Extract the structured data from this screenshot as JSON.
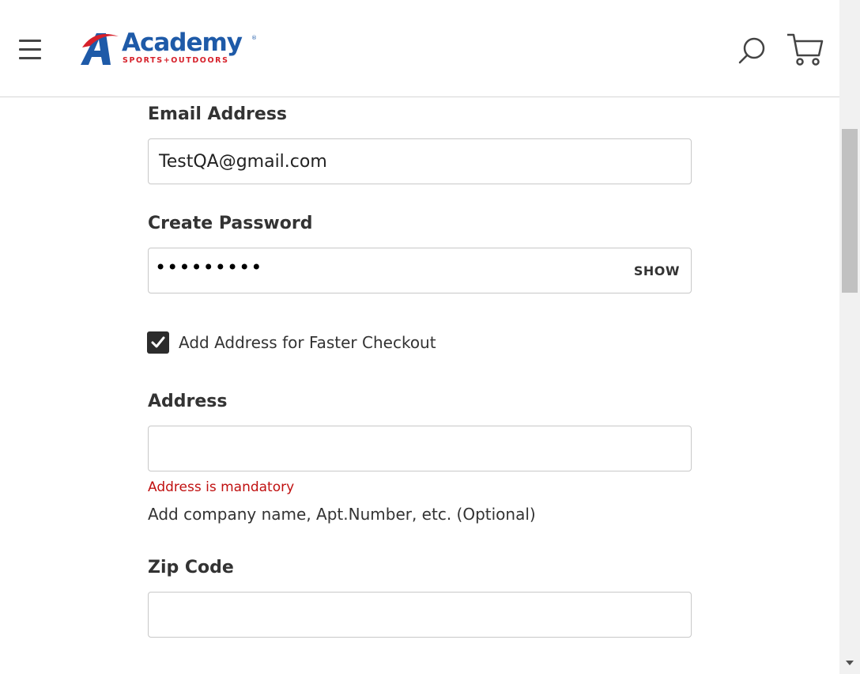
{
  "header": {
    "brand_name": "Academy",
    "brand_tagline": "SPORTS+OUTDOORS",
    "brand_registered": "®",
    "icons": {
      "menu": "hamburger-menu-icon",
      "search": "search-icon",
      "cart": "shopping-cart-icon"
    },
    "colors": {
      "brand_blue": "#1e5aa8",
      "brand_red": "#d6202a"
    }
  },
  "form": {
    "email": {
      "label": "Email Address",
      "value": "TestQA@gmail.com"
    },
    "password": {
      "label": "Create Password",
      "masked_value": "•••••••••",
      "show_label": "SHOW"
    },
    "add_address_checkbox": {
      "label": "Add Address for Faster Checkout",
      "checked": true
    },
    "address": {
      "label": "Address",
      "value": "",
      "error": "Address is mandatory",
      "helper": "Add company name, Apt.Number, etc. (Optional)",
      "error_color": "#c01010"
    },
    "zip": {
      "label": "Zip Code",
      "value": ""
    }
  }
}
